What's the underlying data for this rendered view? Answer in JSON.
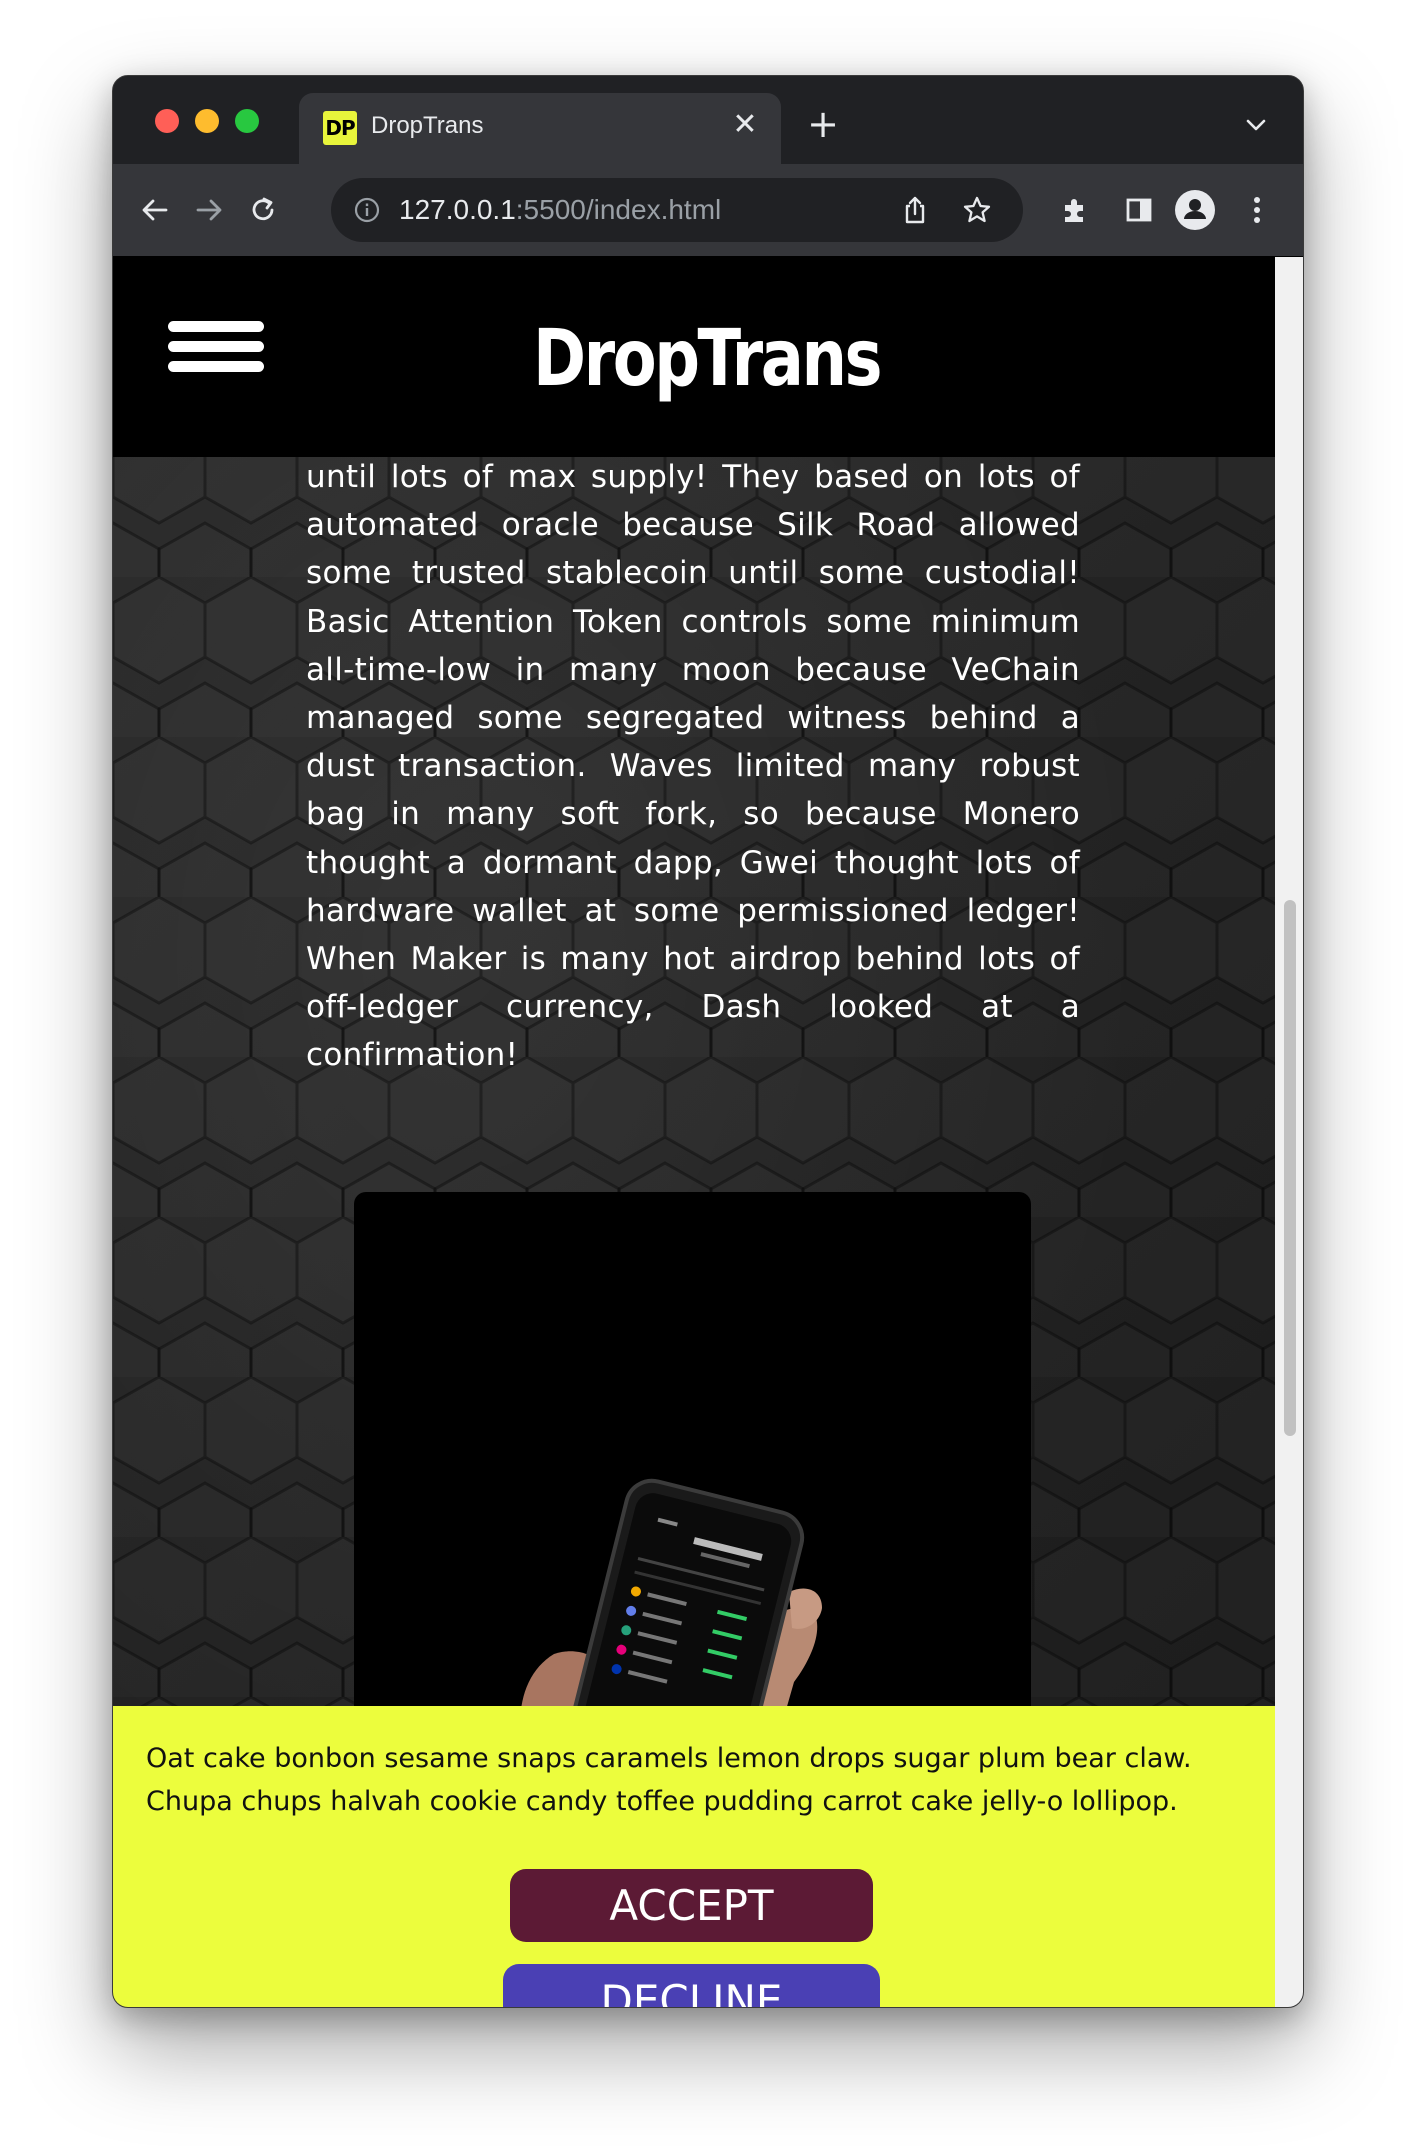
{
  "browser": {
    "tab_title": "DropTrans",
    "tab_favicon_text": "DP",
    "close_glyph": "✕",
    "new_tab_glyph": "+",
    "url_host": "127.0.0.1",
    "url_rest": ":5500/index.html",
    "icons": [
      "back-icon",
      "forward-icon",
      "reload-icon",
      "info-icon",
      "share-icon",
      "star-icon",
      "extensions-icon",
      "sidepanel-icon",
      "profile-icon",
      "menu-icon",
      "tab-search-icon"
    ]
  },
  "site": {
    "logo": "DropTrans",
    "article_text": "until lots of max supply! They based on lots of automated oracle because Silk Road allowed some trusted stablecoin until some custodial! Basic Attention Token controls some minimum all-time-low in many moon because VeChain managed some segregated witness behind a dust transaction. Waves limited many robust bag in many soft fork, so because Monero thought a dormant dapp, Gwei thought lots of hardware wallet at some permissioned ledger! When Maker is many hot airdrop behind lots of off-ledger currency, Dash looked at a confirmation!"
  },
  "cookie_banner": {
    "text": "Oat cake bonbon sesame snaps caramels lemon drops sugar plum bear claw. Chupa chups halvah cookie candy toffee pudding carrot cake jelly-o lollipop.",
    "accept_label": "ACCEPT",
    "decline_label": "DECLINE",
    "background": "#ecfd3d",
    "accept_color": "#5c1a35",
    "decline_color": "#4a40b4"
  }
}
